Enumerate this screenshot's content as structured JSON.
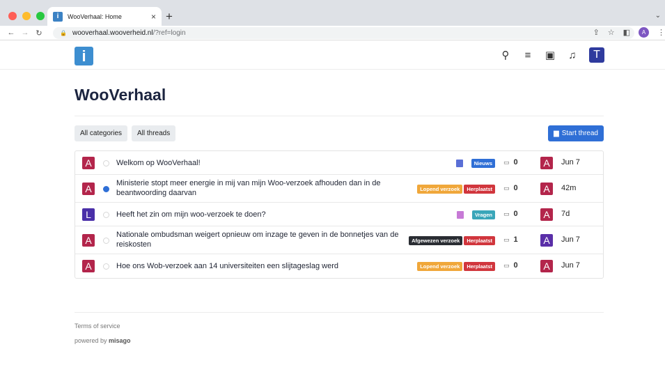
{
  "browser": {
    "tab_title": "WooVerhaal: Home",
    "tab_favicon_letter": "i",
    "url_host": "wooverhaal.wooverheid.nl",
    "url_path": "/?ref=login",
    "profile_initial": "A"
  },
  "site": {
    "logo_letter": "i",
    "user_initial": "T",
    "page_title": "WooVerhaal",
    "filters": {
      "categories": "All categories",
      "threads": "All threads"
    },
    "start_thread": "Start thread"
  },
  "threads": [
    {
      "avatar": "A",
      "avatar_color": "#b3254b",
      "unread": false,
      "title_lines": [
        "Welkom op WooVerhaal!"
      ],
      "cat_icon_color": "#5a6fd6",
      "badges": [
        {
          "label": "Nieuws",
          "color": "#2f6fd6"
        }
      ],
      "replies": "0",
      "last_avatar": "A",
      "last_avatar_color": "#b3254b",
      "time": "Jun 7"
    },
    {
      "avatar": "A",
      "avatar_color": "#b3254b",
      "unread": true,
      "title_lines": [
        "Ministerie stopt meer energie in mij van mijn Woo-verzoek afhouden dan in de",
        "beantwoording daarvan"
      ],
      "cat_icon_color": "",
      "badges": [
        {
          "label": "Lopend verzoek",
          "color": "#f0a73a"
        },
        {
          "label": "Herplaatst",
          "color": "#d1363d"
        }
      ],
      "replies": "0",
      "last_avatar": "A",
      "last_avatar_color": "#b3254b",
      "time": "42m"
    },
    {
      "avatar": "L",
      "avatar_color": "#4a2fa8",
      "unread": false,
      "title_lines": [
        "Heeft het zin om mijn woo-verzoek te doen?"
      ],
      "cat_icon_color": "#c77ad6",
      "badges": [
        {
          "label": "Vragen",
          "color": "#3aa6b9"
        }
      ],
      "replies": "0",
      "last_avatar": "A",
      "last_avatar_color": "#b3254b",
      "time": "7d"
    },
    {
      "avatar": "A",
      "avatar_color": "#b3254b",
      "unread": false,
      "title_lines": [
        "Nationale ombudsman weigert opnieuw om inzage te geven in de bonnetjes van de",
        "reiskosten"
      ],
      "cat_icon_color": "",
      "badges": [
        {
          "label": "Afgewezen verzoek",
          "color": "#2a2d33"
        },
        {
          "label": "Herplaatst",
          "color": "#d1363d"
        }
      ],
      "replies": "1",
      "last_avatar": "A",
      "last_avatar_color": "#5a2fa8",
      "time": "Jun 7"
    },
    {
      "avatar": "A",
      "avatar_color": "#b3254b",
      "unread": false,
      "title_lines": [
        "Hoe ons Wob-verzoek aan 14 universiteiten een slijtageslag werd"
      ],
      "cat_icon_color": "",
      "badges": [
        {
          "label": "Lopend verzoek",
          "color": "#f0a73a"
        },
        {
          "label": "Herplaatst",
          "color": "#d1363d"
        }
      ],
      "replies": "0",
      "last_avatar": "A",
      "last_avatar_color": "#b3254b",
      "time": "Jun 7"
    }
  ],
  "footer": {
    "terms": "Terms of service",
    "powered_prefix": "powered by",
    "powered_brand": "misago"
  }
}
